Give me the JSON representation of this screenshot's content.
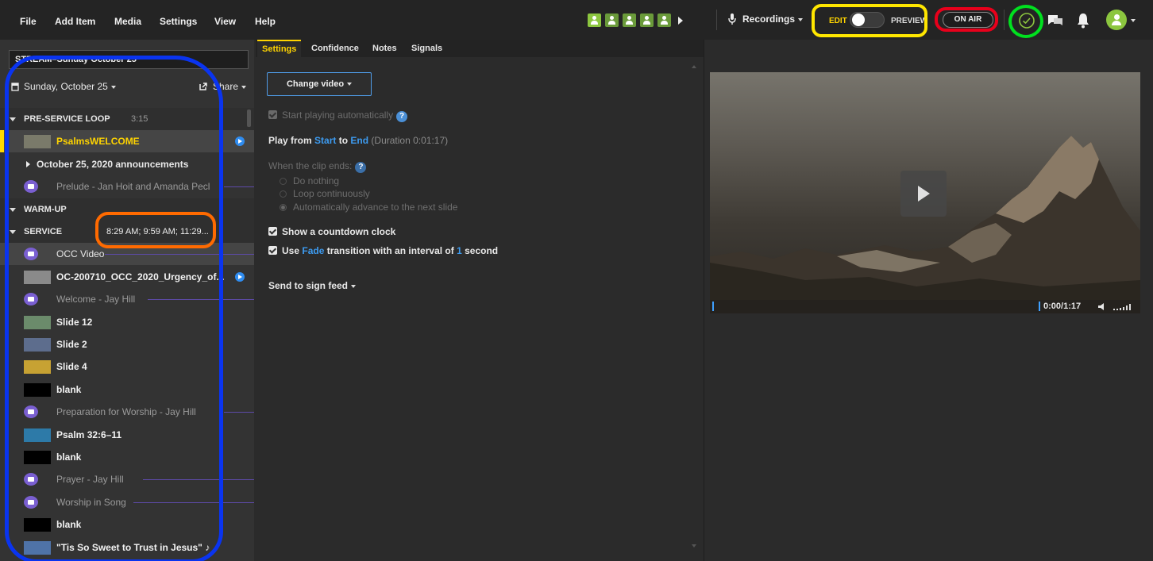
{
  "menu": {
    "file": "File",
    "add_item": "Add Item",
    "media": "Media",
    "settings": "Settings",
    "view": "View",
    "help": "Help"
  },
  "toolbar": {
    "recordings": "Recordings",
    "edit": "EDIT",
    "preview": "PREVIEW",
    "on_air": "ON AIR",
    "people_icons": [
      "person-icon",
      "person-icon",
      "person-icon",
      "person-icon",
      "person-icon"
    ]
  },
  "left_panel": {
    "stream_title": "STREAM–Sunday October 25",
    "date_label": "Sunday, October 25",
    "share_label": "Share",
    "items": [
      {
        "kind": "section",
        "label": "PRE-SERVICE LOOP",
        "extra": "3:15"
      },
      {
        "kind": "media",
        "label": "PsalmsWELCOME",
        "thumb": "#7a7a6a",
        "selected": true,
        "play": true
      },
      {
        "kind": "group",
        "label": "October 25, 2020 announcements"
      },
      {
        "kind": "cue",
        "label": "Prelude - Jan Hoit and Amanda Pecl"
      },
      {
        "kind": "section",
        "label": "WARM-UP",
        "extra": ""
      },
      {
        "kind": "section",
        "label": "SERVICE",
        "extra": "8:29 AM; 9:59 AM; 11:29..."
      },
      {
        "kind": "cue",
        "label": "OCC Video",
        "highlight": true
      },
      {
        "kind": "media",
        "label": "OC-200710_OCC_2020_Urgency_of...",
        "thumb": "#8a8a8a",
        "play": true
      },
      {
        "kind": "cue",
        "label": "Welcome - Jay Hill"
      },
      {
        "kind": "media",
        "label": "Slide 12",
        "thumb": "#6b8b6b"
      },
      {
        "kind": "media",
        "label": "Slide 2",
        "thumb": "#5d6d8d"
      },
      {
        "kind": "media",
        "label": "Slide 4",
        "thumb": "#c7a233"
      },
      {
        "kind": "media",
        "label": "blank",
        "thumb": "#000000"
      },
      {
        "kind": "cue",
        "label": "Preparation for Worship - Jay Hill"
      },
      {
        "kind": "media",
        "label": "Psalm 32:6–11",
        "thumb": "#2d7aa8"
      },
      {
        "kind": "media",
        "label": "blank",
        "thumb": "#000000"
      },
      {
        "kind": "cue",
        "label": "Prayer - Jay Hill"
      },
      {
        "kind": "cue",
        "label": "Worship in Song"
      },
      {
        "kind": "media",
        "label": "blank",
        "thumb": "#000000"
      },
      {
        "kind": "media",
        "label": "\"Tis So Sweet to Trust in Jesus\" ♪",
        "thumb": "#4f73a8"
      }
    ]
  },
  "tabs": [
    "Settings",
    "Confidence",
    "Notes",
    "Signals"
  ],
  "middle": {
    "change_video": "Change video",
    "start_auto": "Start playing automatically",
    "play_from": "Play from",
    "start": "Start",
    "to": "to",
    "end": "End",
    "duration": "(Duration 0:01:17)",
    "clip_ends": "When the clip ends:",
    "opt_nothing": "Do nothing",
    "opt_loop": "Loop continuously",
    "opt_advance": "Automatically advance to the next slide",
    "countdown": "Show a countdown clock",
    "use": "Use",
    "fade": "Fade",
    "transition_text": "transition with an interval of",
    "interval": "1",
    "second": "second",
    "send_sign": "Send to sign feed"
  },
  "video": {
    "time": "0:00/1:17"
  },
  "colors": {
    "accent_yellow": "#ffd400",
    "link_blue": "#3d9bf0",
    "people_green": "#8cc63f"
  }
}
